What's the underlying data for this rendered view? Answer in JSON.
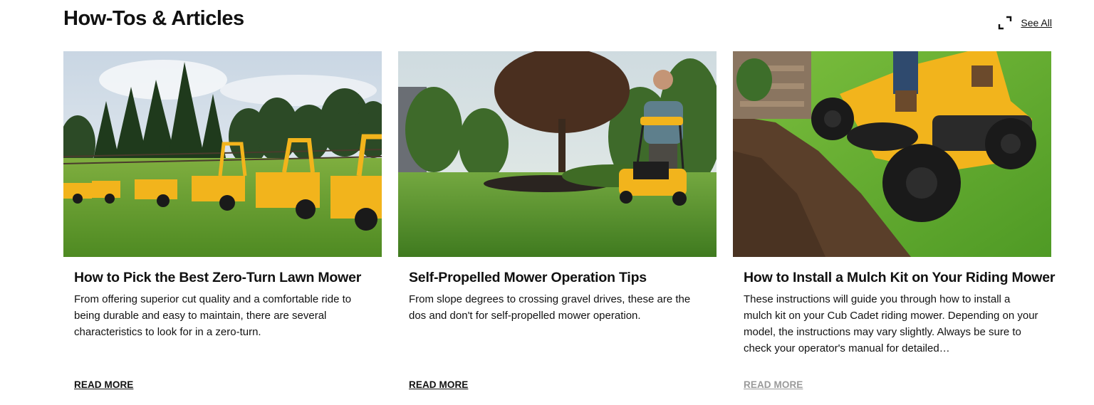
{
  "section": {
    "heading": "How-Tos & Articles",
    "see_all_label": "See All",
    "see_all_icon": "expand-icon"
  },
  "articles": [
    {
      "title": "How to Pick the Best Zero-Turn Lawn Mower",
      "description": "From offering superior cut quality and a comfortable ride to being durable and easy to maintain, there are several characteristics to look for in a zero-turn.",
      "read_more_label": "READ MORE",
      "image_subject": "zero-turn-mowers-photo"
    },
    {
      "title": "Self-Propelled Mower Operation Tips",
      "description": "From slope degrees to crossing gravel drives, these are the dos and don't for self-propelled mower operation.",
      "read_more_label": "READ MORE",
      "image_subject": "push-mower-photo"
    },
    {
      "title": "How to Install a Mulch Kit on Your Riding Mower",
      "description": "These instructions will guide you through how to install a mulch kit on your Cub Cadet riding mower. Depending on your model, the instructions may vary slightly. Always be sure to check your operator's manual for detailed…",
      "read_more_label": "READ MORE",
      "image_subject": "riding-mower-photo"
    }
  ],
  "colors": {
    "brand_yellow": "#f2b41c",
    "grass_green": "#5f9b2d",
    "text": "#111111",
    "muted_link": "#9a9a9a"
  }
}
